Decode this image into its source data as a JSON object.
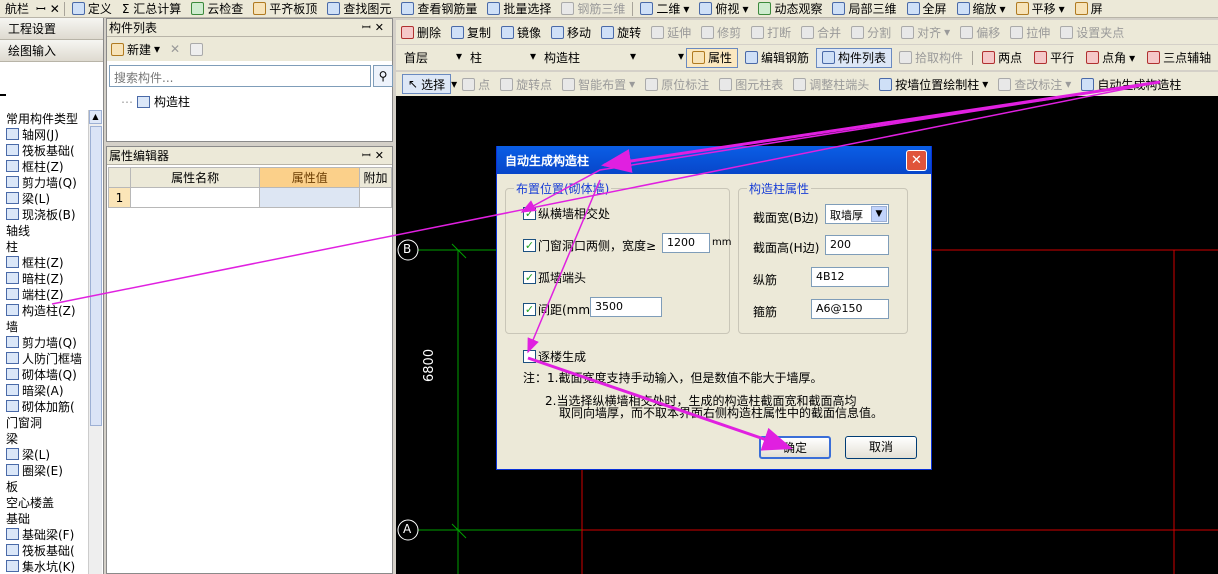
{
  "toolbar_top": {
    "nav_title": "航栏",
    "items": [
      "定义",
      "Σ 汇总计算",
      "云检查",
      "平齐板顶",
      "查找图元",
      "查看钢筋量",
      "批量选择",
      "钢筋三维",
      "二维",
      "俯视",
      "动态观察",
      "局部三维",
      "全屏",
      "缩放",
      "平移",
      "屏"
    ]
  },
  "left_nav": {
    "buttons": [
      "工程设置",
      "绘图输入"
    ],
    "tree": [
      {
        "t": "cat",
        "label": "常用构件类型"
      },
      {
        "t": "it",
        "label": "轴网(J)"
      },
      {
        "t": "it",
        "label": "筏板基础("
      },
      {
        "t": "it",
        "label": "框柱(Z)"
      },
      {
        "t": "it",
        "label": "剪力墙(Q)"
      },
      {
        "t": "it",
        "label": "梁(L)"
      },
      {
        "t": "it",
        "label": "现浇板(B)"
      },
      {
        "t": "cat",
        "label": "轴线"
      },
      {
        "t": "cat",
        "label": "柱"
      },
      {
        "t": "it",
        "label": "框柱(Z)"
      },
      {
        "t": "it",
        "label": "暗柱(Z)"
      },
      {
        "t": "it",
        "label": "端柱(Z)"
      },
      {
        "t": "it",
        "label": "构造柱(Z)"
      },
      {
        "t": "cat",
        "label": "墙"
      },
      {
        "t": "it",
        "label": "剪力墙(Q)"
      },
      {
        "t": "it",
        "label": "人防门框墙"
      },
      {
        "t": "it",
        "label": "砌体墙(Q)"
      },
      {
        "t": "it",
        "label": "暗梁(A)"
      },
      {
        "t": "it",
        "label": "砌体加筋("
      },
      {
        "t": "cat",
        "label": "门窗洞"
      },
      {
        "t": "cat",
        "label": "梁"
      },
      {
        "t": "it",
        "label": "梁(L)"
      },
      {
        "t": "it",
        "label": "圈梁(E)"
      },
      {
        "t": "cat",
        "label": "板"
      },
      {
        "t": "cat",
        "label": "空心楼盖"
      },
      {
        "t": "cat",
        "label": "基础"
      },
      {
        "t": "it",
        "label": "基础梁(F)"
      },
      {
        "t": "it",
        "label": "筏板基础("
      },
      {
        "t": "it",
        "label": "集水坑(K)"
      }
    ]
  },
  "component_list": {
    "title": "构件列表",
    "new_label": "新建",
    "search_placeholder": "搜索构件...",
    "node": "构造柱"
  },
  "property_editor": {
    "title": "属性编辑器",
    "col_name": "属性名称",
    "col_value": "属性值",
    "col_extra": "附加",
    "row_num": "1"
  },
  "toolbar2": {
    "items": [
      "删除",
      "复制",
      "镜像",
      "移动",
      "旋转",
      "延伸",
      "修剪",
      "打断",
      "合并",
      "分割",
      "对齐",
      "偏移",
      "拉伸",
      "设置夹点"
    ]
  },
  "toolbar3": {
    "floor": "首层",
    "type": "柱",
    "component": "构造柱",
    "items": [
      "属性",
      "编辑钢筋",
      "构件列表",
      "拾取构件",
      "两点",
      "平行",
      "点角",
      "三点辅轴"
    ]
  },
  "toolbar4": {
    "items": [
      "选择",
      "点",
      "旋转点",
      "智能布置",
      "原位标注",
      "图元柱表",
      "调整柱端头",
      "按墙位置绘制柱",
      "查改标注",
      "自动生成构造柱"
    ]
  },
  "canvas": {
    "axis_b": "B",
    "axis_a": "A",
    "dimension": "6800"
  },
  "dialog": {
    "title": "自动生成构造柱",
    "group_left": "布置位置(砌体墙)",
    "cb_cross": "纵横墙相交处",
    "cb_door": "门窗洞口两侧，宽度≥",
    "door_width": "1200",
    "door_unit": "mm",
    "cb_isolated": "孤墙端头",
    "cb_spacing": "间距(mm)",
    "spacing": "3500",
    "group_right": "构造柱属性",
    "lbl_width": "截面宽(B边)",
    "width_value": "取墙厚",
    "lbl_height": "截面高(H边)",
    "height_value": "200",
    "lbl_long": "纵筋",
    "long_value": "4B12",
    "lbl_stirrup": "箍筋",
    "stirrup_value": "A6@150",
    "cb_floor": "逐楼生成",
    "note1": "注：1.截面宽度支持手动输入，但是数值不能大于墙厚。",
    "note2a": "2.当选择纵横墙相交处时，生成的构造柱截面宽和截面高均",
    "note2b": "取同向墙厚，而不取本界面右侧构造柱属性中的截面信息值。",
    "ok": "确定",
    "cancel": "取消",
    "check": "✓"
  }
}
